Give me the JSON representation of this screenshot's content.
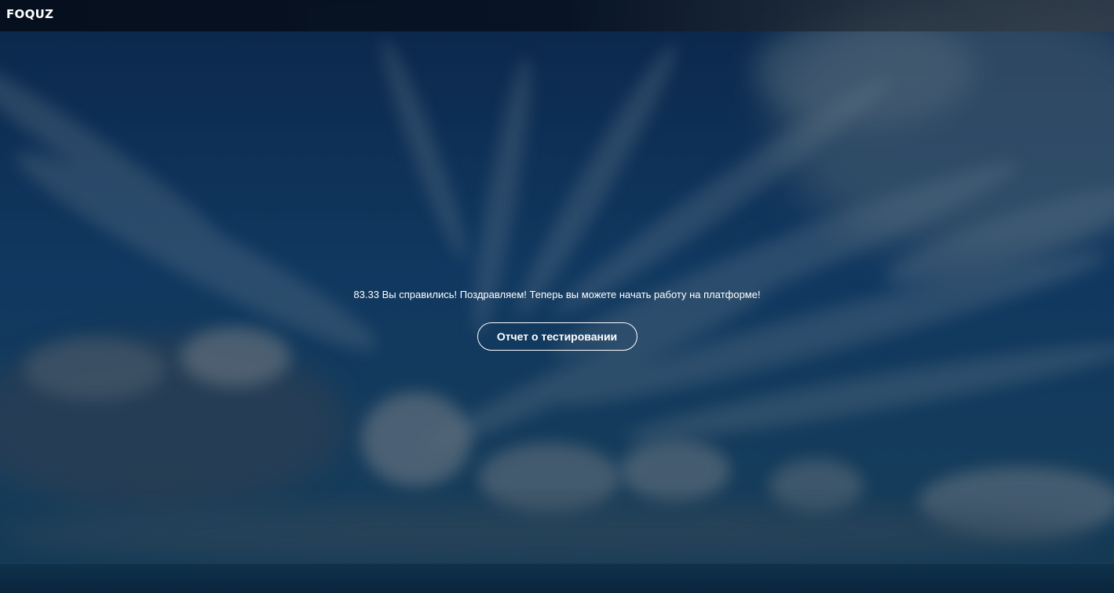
{
  "header": {
    "logo_text": "FOQUZ"
  },
  "result": {
    "score": "83.33",
    "message": "Вы справились! Поздравляем! Теперь вы можете начать работу на платформе!"
  },
  "report_button": {
    "label": "Отчет о тестировании"
  },
  "colors": {
    "sky_dark": "#0d2d55",
    "sky_mid": "#1a5284",
    "sea": "#0f3752",
    "text": "#ffffff"
  }
}
